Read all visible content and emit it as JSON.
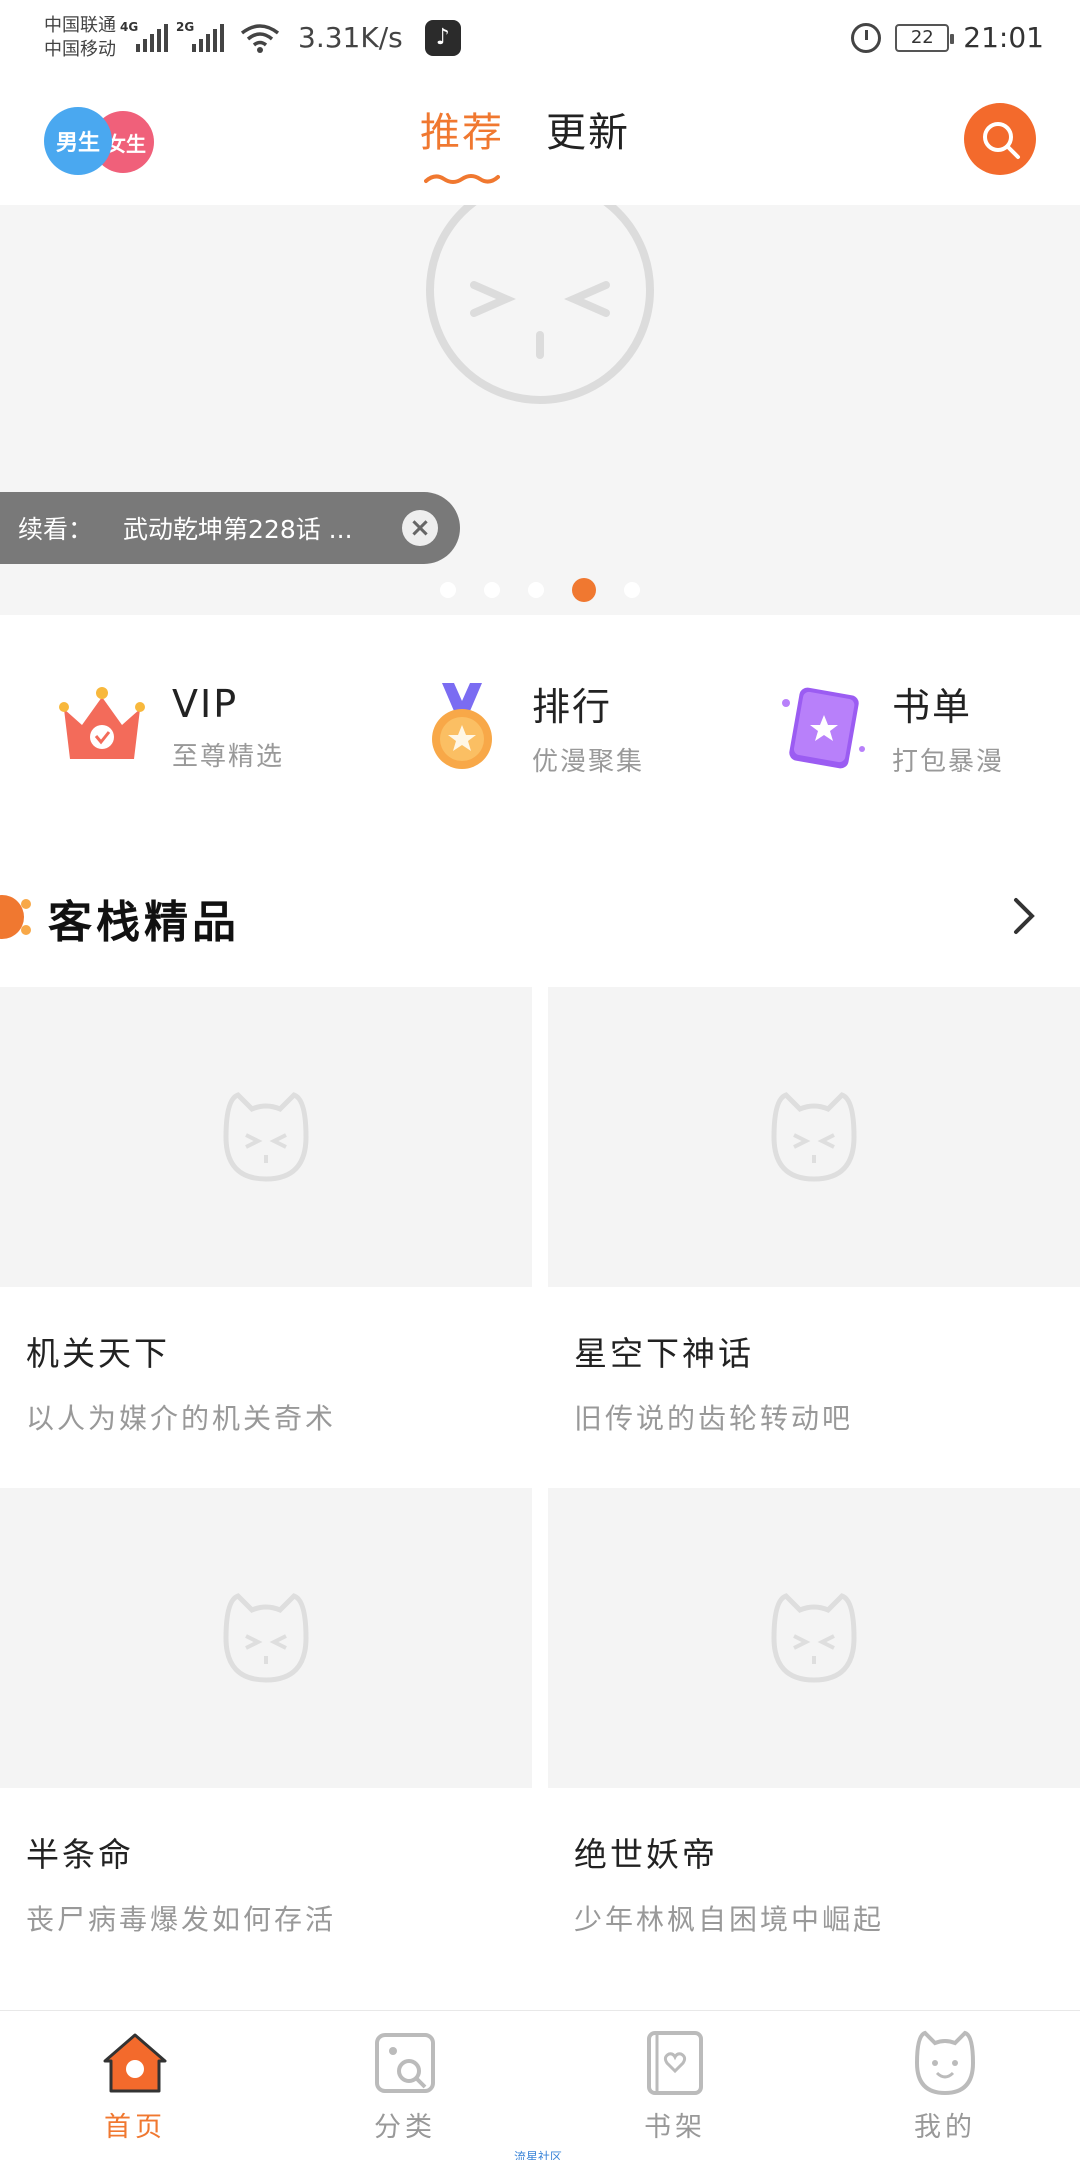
{
  "status_bar": {
    "carrier1": "中国联通",
    "carrier2": "中国移动",
    "network1": "4G",
    "network2": "2G",
    "speed": "3.31K/s",
    "battery": "22",
    "time": "21:01",
    "app_icon": "tiktok-icon"
  },
  "header": {
    "gender_boy": "男生",
    "gender_girl": "女生",
    "tabs": [
      {
        "label": "推荐",
        "active": true
      },
      {
        "label": "更新",
        "active": false
      }
    ],
    "accent": "#f07830"
  },
  "banner": {
    "continue_label": "续看：",
    "continue_title": "武动乾坤第228话 ...",
    "close_icon": "close-icon",
    "dots_count": 5,
    "active_dot_index": 3
  },
  "features": [
    {
      "title": "VIP",
      "subtitle": "至尊精选",
      "icon": "crown-icon"
    },
    {
      "title": "排行",
      "subtitle": "优漫聚集",
      "icon": "medal-icon"
    },
    {
      "title": "书单",
      "subtitle": "打包暴漫",
      "icon": "book-icon"
    }
  ],
  "section": {
    "title": "客栈精品"
  },
  "cards": [
    {
      "name": "机关天下",
      "desc": "以人为媒介的机关奇术"
    },
    {
      "name": "星空下神话",
      "desc": "旧传说的齿轮转动吧"
    },
    {
      "name": "半条命",
      "desc": "丧尸病毒爆发如何存活"
    },
    {
      "name": "绝世妖帝",
      "desc": "少年林枫自困境中崛起"
    }
  ],
  "bottom_nav": [
    {
      "label": "首页",
      "icon": "home-icon",
      "active": true
    },
    {
      "label": "分类",
      "icon": "category-icon",
      "active": false
    },
    {
      "label": "书架",
      "icon": "bookshelf-icon",
      "active": false
    },
    {
      "label": "我的",
      "icon": "profile-icon",
      "active": false
    }
  ],
  "watermark": "流星社区"
}
